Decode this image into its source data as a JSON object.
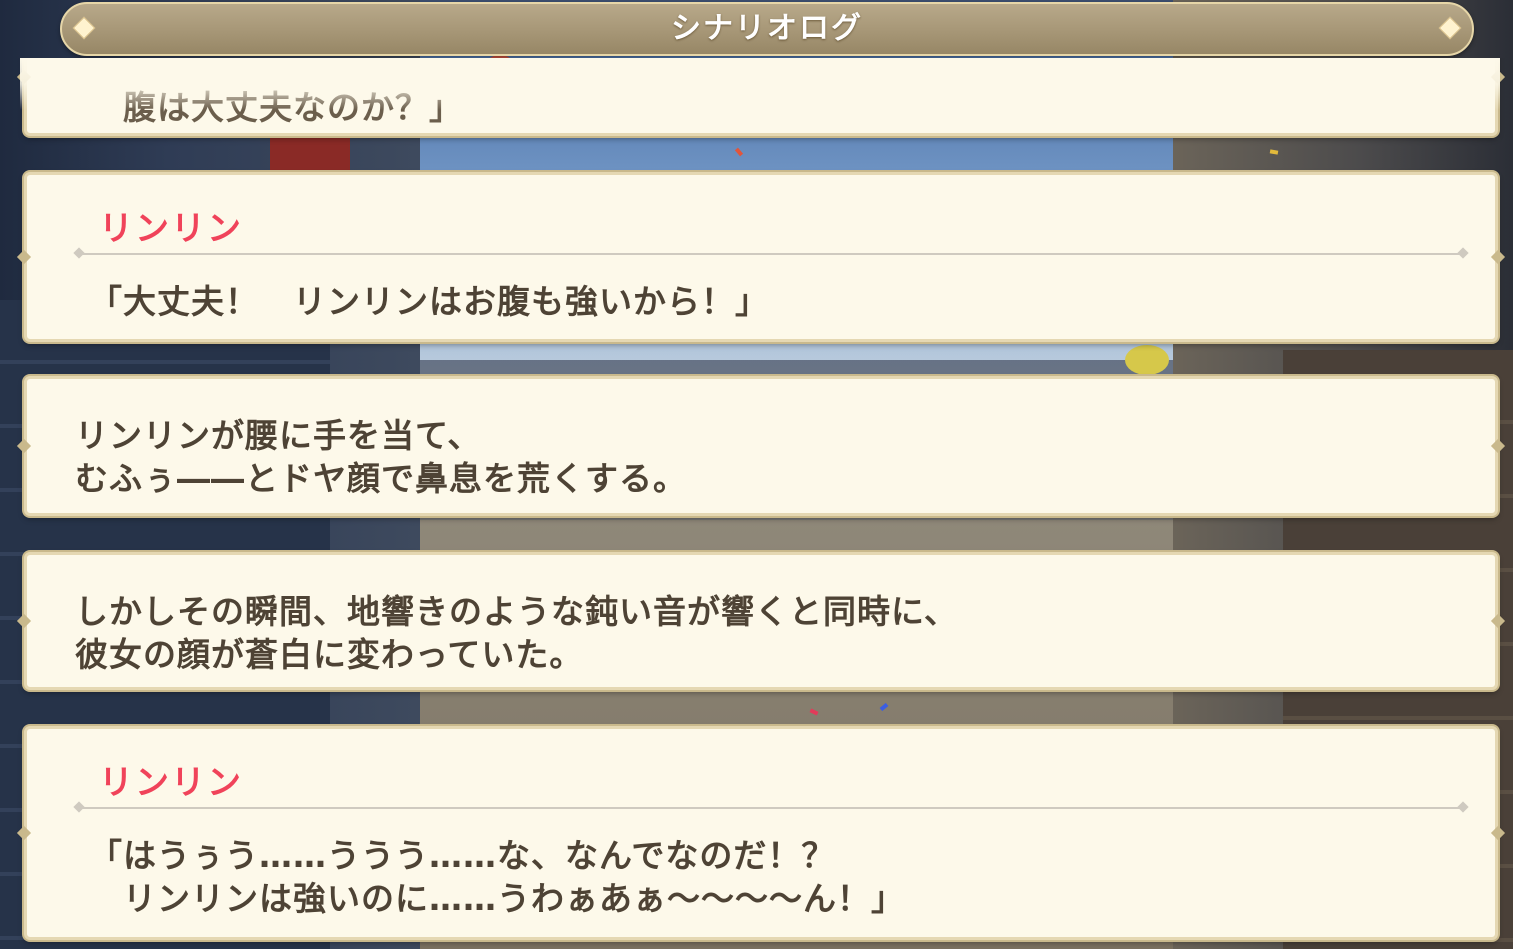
{
  "header": {
    "title": "シナリオログ"
  },
  "log": [
    {
      "type": "dialogue",
      "speaker": "",
      "lines": [
        "　腹は大丈夫なのか？」"
      ]
    },
    {
      "type": "dialogue",
      "speaker": "リンリン",
      "lines": [
        "「大丈夫！　リンリンはお腹も強いから！」"
      ]
    },
    {
      "type": "narration",
      "lines": [
        "リンリンが腰に手を当て、",
        "むふぅ――とドヤ顔で鼻息を荒くする。"
      ]
    },
    {
      "type": "narration",
      "lines": [
        "しかしその瞬間、地響きのような鈍い音が響くと同時に、",
        "彼女の顔が蒼白に変わっていた。"
      ]
    },
    {
      "type": "dialogue",
      "speaker": "リンリン",
      "lines": [
        "「はうぅう……ううう……な、なんでなのだ！？",
        "　リンリンは強いのに……うわぁあぁ～～～～ん！」"
      ]
    }
  ],
  "colors": {
    "speaker": "#f0435a",
    "text": "#4e4335",
    "panel": "#fdf9ea",
    "header": "#a89878"
  }
}
